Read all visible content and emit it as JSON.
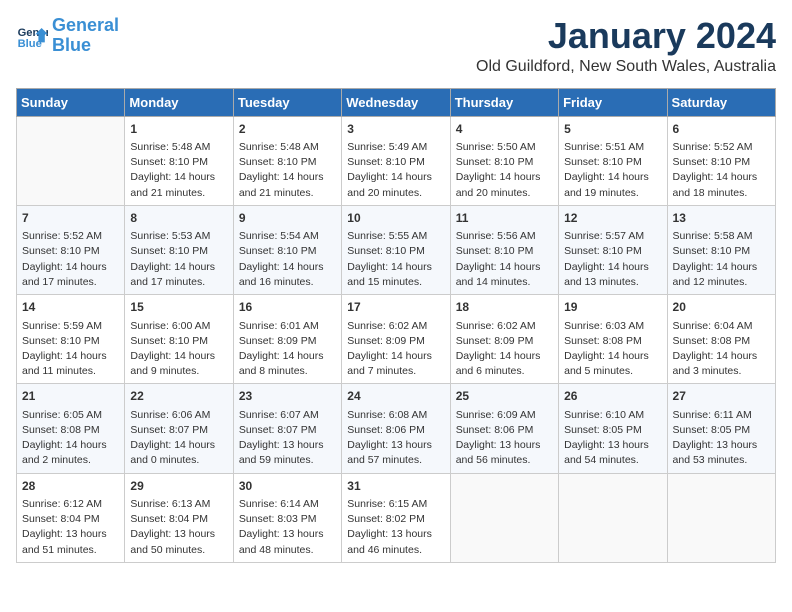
{
  "header": {
    "logo_line1": "General",
    "logo_line2": "Blue",
    "title": "January 2024",
    "subtitle": "Old Guildford, New South Wales, Australia"
  },
  "days_of_week": [
    "Sunday",
    "Monday",
    "Tuesday",
    "Wednesday",
    "Thursday",
    "Friday",
    "Saturday"
  ],
  "weeks": [
    [
      {
        "day": "",
        "content": ""
      },
      {
        "day": "1",
        "content": "Sunrise: 5:48 AM\nSunset: 8:10 PM\nDaylight: 14 hours\nand 21 minutes."
      },
      {
        "day": "2",
        "content": "Sunrise: 5:48 AM\nSunset: 8:10 PM\nDaylight: 14 hours\nand 21 minutes."
      },
      {
        "day": "3",
        "content": "Sunrise: 5:49 AM\nSunset: 8:10 PM\nDaylight: 14 hours\nand 20 minutes."
      },
      {
        "day": "4",
        "content": "Sunrise: 5:50 AM\nSunset: 8:10 PM\nDaylight: 14 hours\nand 20 minutes."
      },
      {
        "day": "5",
        "content": "Sunrise: 5:51 AM\nSunset: 8:10 PM\nDaylight: 14 hours\nand 19 minutes."
      },
      {
        "day": "6",
        "content": "Sunrise: 5:52 AM\nSunset: 8:10 PM\nDaylight: 14 hours\nand 18 minutes."
      }
    ],
    [
      {
        "day": "7",
        "content": "Sunrise: 5:52 AM\nSunset: 8:10 PM\nDaylight: 14 hours\nand 17 minutes."
      },
      {
        "day": "8",
        "content": "Sunrise: 5:53 AM\nSunset: 8:10 PM\nDaylight: 14 hours\nand 17 minutes."
      },
      {
        "day": "9",
        "content": "Sunrise: 5:54 AM\nSunset: 8:10 PM\nDaylight: 14 hours\nand 16 minutes."
      },
      {
        "day": "10",
        "content": "Sunrise: 5:55 AM\nSunset: 8:10 PM\nDaylight: 14 hours\nand 15 minutes."
      },
      {
        "day": "11",
        "content": "Sunrise: 5:56 AM\nSunset: 8:10 PM\nDaylight: 14 hours\nand 14 minutes."
      },
      {
        "day": "12",
        "content": "Sunrise: 5:57 AM\nSunset: 8:10 PM\nDaylight: 14 hours\nand 13 minutes."
      },
      {
        "day": "13",
        "content": "Sunrise: 5:58 AM\nSunset: 8:10 PM\nDaylight: 14 hours\nand 12 minutes."
      }
    ],
    [
      {
        "day": "14",
        "content": "Sunrise: 5:59 AM\nSunset: 8:10 PM\nDaylight: 14 hours\nand 11 minutes."
      },
      {
        "day": "15",
        "content": "Sunrise: 6:00 AM\nSunset: 8:10 PM\nDaylight: 14 hours\nand 9 minutes."
      },
      {
        "day": "16",
        "content": "Sunrise: 6:01 AM\nSunset: 8:09 PM\nDaylight: 14 hours\nand 8 minutes."
      },
      {
        "day": "17",
        "content": "Sunrise: 6:02 AM\nSunset: 8:09 PM\nDaylight: 14 hours\nand 7 minutes."
      },
      {
        "day": "18",
        "content": "Sunrise: 6:02 AM\nSunset: 8:09 PM\nDaylight: 14 hours\nand 6 minutes."
      },
      {
        "day": "19",
        "content": "Sunrise: 6:03 AM\nSunset: 8:08 PM\nDaylight: 14 hours\nand 5 minutes."
      },
      {
        "day": "20",
        "content": "Sunrise: 6:04 AM\nSunset: 8:08 PM\nDaylight: 14 hours\nand 3 minutes."
      }
    ],
    [
      {
        "day": "21",
        "content": "Sunrise: 6:05 AM\nSunset: 8:08 PM\nDaylight: 14 hours\nand 2 minutes."
      },
      {
        "day": "22",
        "content": "Sunrise: 6:06 AM\nSunset: 8:07 PM\nDaylight: 14 hours\nand 0 minutes."
      },
      {
        "day": "23",
        "content": "Sunrise: 6:07 AM\nSunset: 8:07 PM\nDaylight: 13 hours\nand 59 minutes."
      },
      {
        "day": "24",
        "content": "Sunrise: 6:08 AM\nSunset: 8:06 PM\nDaylight: 13 hours\nand 57 minutes."
      },
      {
        "day": "25",
        "content": "Sunrise: 6:09 AM\nSunset: 8:06 PM\nDaylight: 13 hours\nand 56 minutes."
      },
      {
        "day": "26",
        "content": "Sunrise: 6:10 AM\nSunset: 8:05 PM\nDaylight: 13 hours\nand 54 minutes."
      },
      {
        "day": "27",
        "content": "Sunrise: 6:11 AM\nSunset: 8:05 PM\nDaylight: 13 hours\nand 53 minutes."
      }
    ],
    [
      {
        "day": "28",
        "content": "Sunrise: 6:12 AM\nSunset: 8:04 PM\nDaylight: 13 hours\nand 51 minutes."
      },
      {
        "day": "29",
        "content": "Sunrise: 6:13 AM\nSunset: 8:04 PM\nDaylight: 13 hours\nand 50 minutes."
      },
      {
        "day": "30",
        "content": "Sunrise: 6:14 AM\nSunset: 8:03 PM\nDaylight: 13 hours\nand 48 minutes."
      },
      {
        "day": "31",
        "content": "Sunrise: 6:15 AM\nSunset: 8:02 PM\nDaylight: 13 hours\nand 46 minutes."
      },
      {
        "day": "",
        "content": ""
      },
      {
        "day": "",
        "content": ""
      },
      {
        "day": "",
        "content": ""
      }
    ]
  ]
}
